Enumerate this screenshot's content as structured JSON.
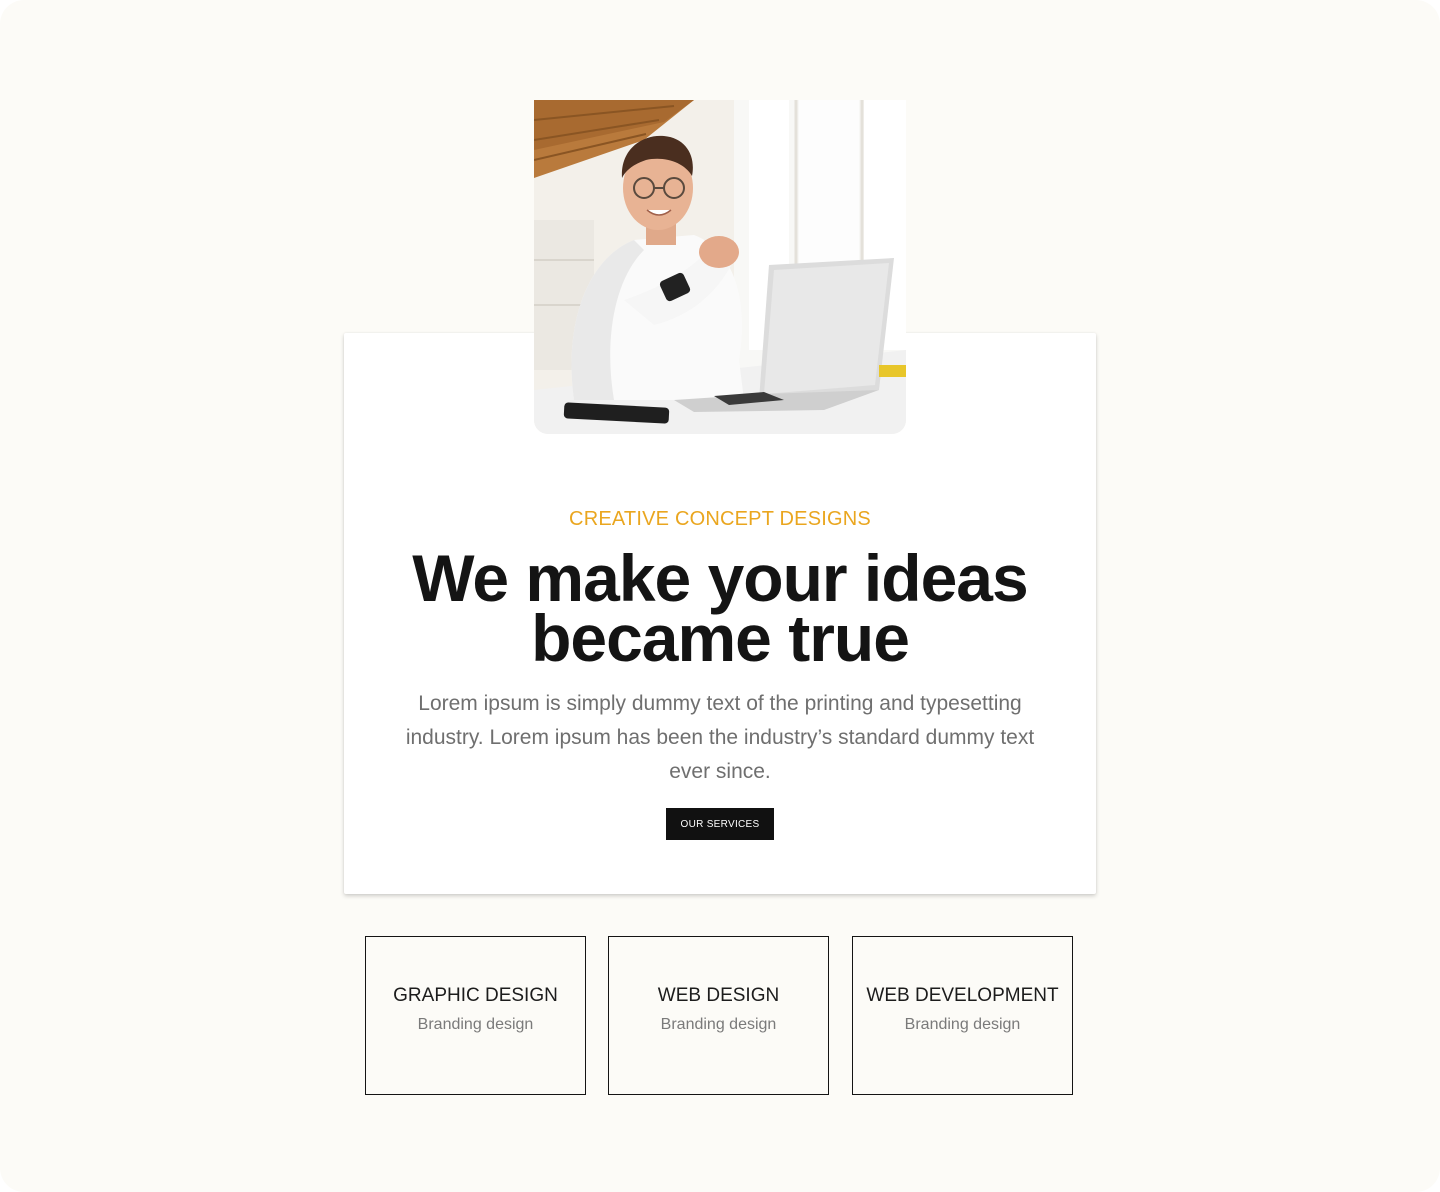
{
  "hero": {
    "eyebrow": "CREATIVE CONCEPT DESIGNS",
    "headline_line1": "We make your ideas",
    "headline_line2": "became true",
    "description": "Lorem ipsum is simply dummy text of the printing and typesetting industry. Lorem ipsum has been the industry’s standard dummy text ever since.",
    "cta_label": "OUR SERVICES",
    "photo_alt": "Smiling man in white shirt sitting at a desk with a laptop"
  },
  "services": [
    {
      "title": "GRAPHIC DESIGN",
      "subtitle": "Branding design"
    },
    {
      "title": "WEB DESIGN",
      "subtitle": "Branding design"
    },
    {
      "title": "WEB DEVELOPMENT",
      "subtitle": "Branding design"
    }
  ],
  "colors": {
    "background": "#fcfbf7",
    "accent": "#eaa61f",
    "text_dark": "#141414",
    "text_muted": "#6f6f6f",
    "button_bg": "#111111"
  }
}
